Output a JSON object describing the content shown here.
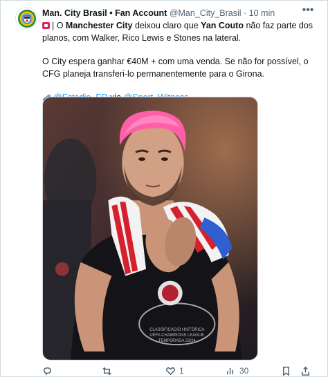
{
  "tweet": {
    "author_name": "Man. City Brasil • Fan Account",
    "handle": "@Man_City_Brasil",
    "separator": "·",
    "time": "10 min",
    "paragraph1": {
      "pre": "| O ",
      "b1": "Manchester City",
      "mid": " deixou claro que ",
      "b2": "Yan Couto",
      "post": " não faz parte dos planos, com Walker, Rico Lewis e Stones na lateral."
    },
    "paragraph2": "O City espera ganhar €40M + com uma venda. Se não for possível, o CFG planeja transferi-lo permanentemente para o Girona.",
    "source": {
      "link1": "@Estadio_ED",
      "via": " via ",
      "link2": "@Sport_Witness"
    }
  },
  "actions": {
    "reply_count": "",
    "retweet_count": "",
    "like_count": "1",
    "views_count": "30"
  },
  "icons": {
    "avatar": "man-city-crest-icon",
    "more": "more-dots-icon",
    "flag": "flag-emoji-icon",
    "pen": "pen-emoji-icon",
    "reply": "reply-icon",
    "retweet": "retweet-icon",
    "like": "heart-icon",
    "views": "views-chart-icon",
    "bookmark": "bookmark-icon",
    "share": "share-icon"
  },
  "colors": {
    "link": "#1d9bf0",
    "text": "#0f1419",
    "muted": "#536471",
    "hair": "#ff5fa8"
  }
}
